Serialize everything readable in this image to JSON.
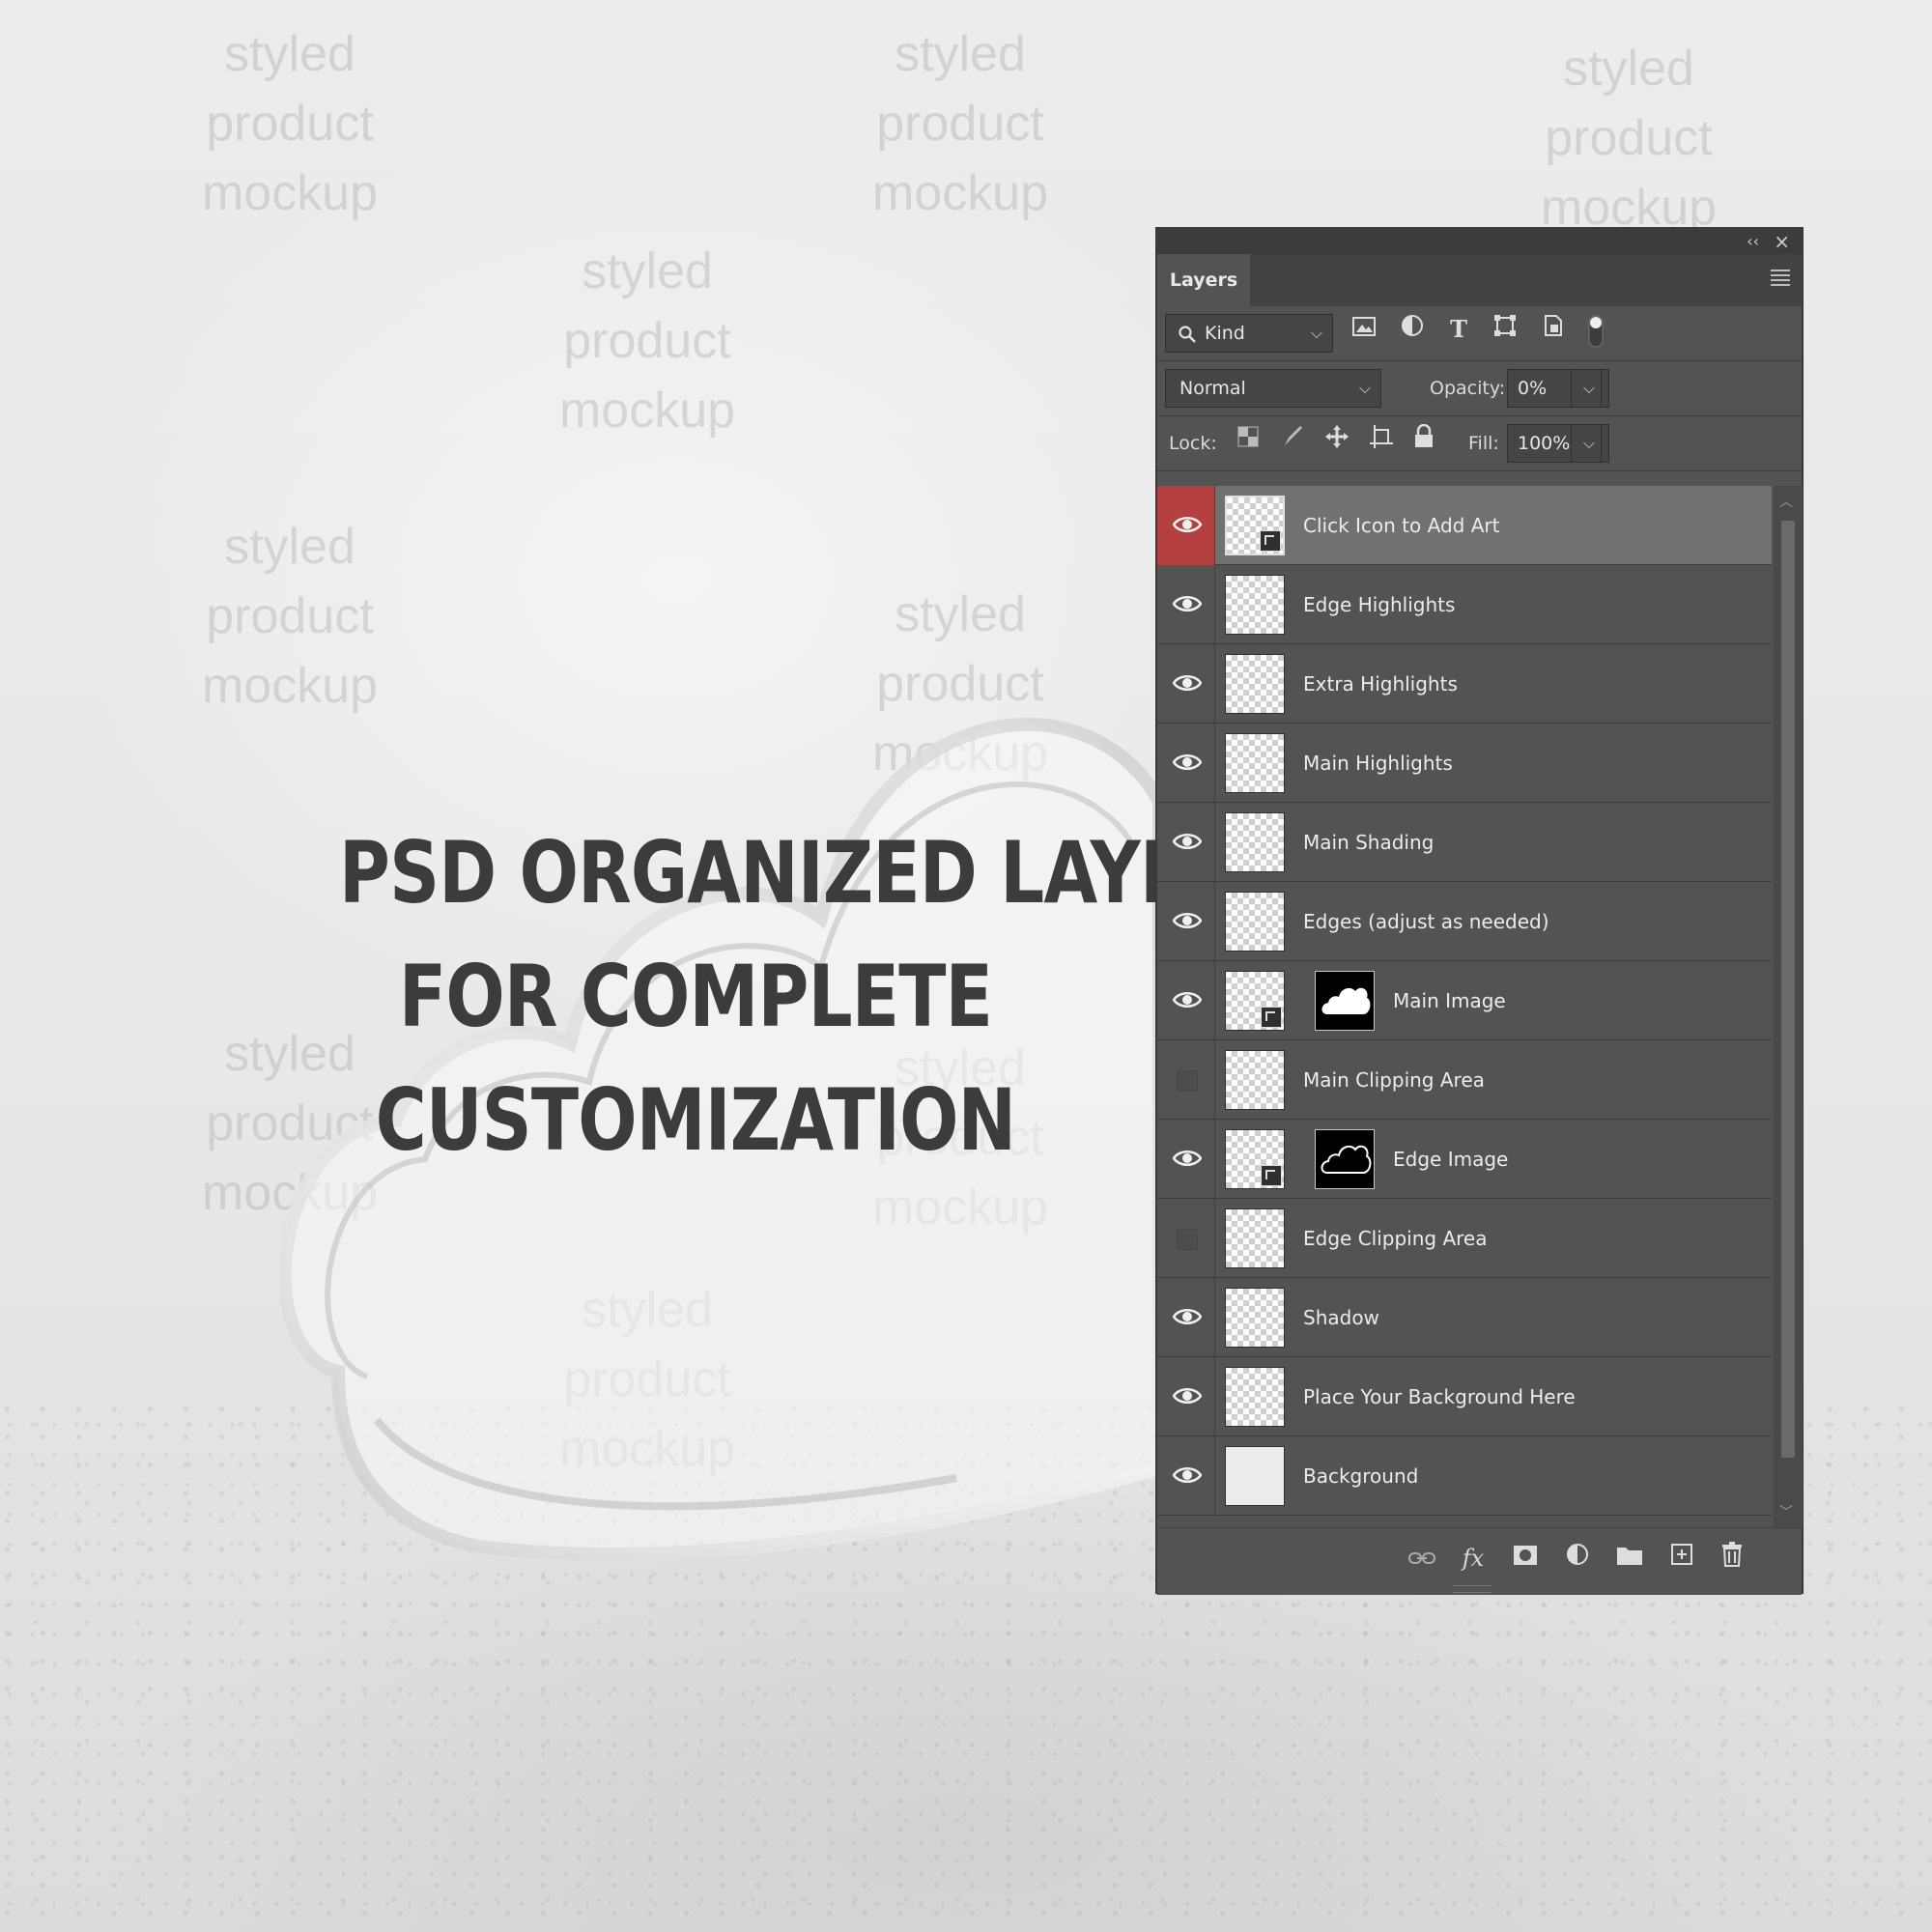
{
  "watermark": {
    "line1": "styled",
    "line2": "product",
    "line3": "mockup"
  },
  "headline": {
    "line1": "PSD ORGANIZED LAYERS",
    "line2": "FOR COMPLETE",
    "line3": "CUSTOMIZATION"
  },
  "panel": {
    "collapse_glyph": "‹‹",
    "close_glyph": "×",
    "tab_label": "Layers",
    "filter": {
      "kind_label": "Kind",
      "icons": [
        "image-filter-icon",
        "adjustment-filter-icon",
        "type-filter-icon",
        "shape-filter-icon",
        "smart-object-filter-icon",
        "filter-toggle-icon"
      ]
    },
    "blend_mode": "Normal",
    "opacity_label": "Opacity:",
    "opacity_value": "0%",
    "lock_label": "Lock:",
    "fill_label": "Fill:",
    "fill_value": "100%",
    "layers": [
      {
        "name": "Click Icon to Add Art",
        "visible": true,
        "selected": true,
        "thumb": "smart-object",
        "mask": ""
      },
      {
        "name": "Edge Highlights",
        "visible": true,
        "selected": false,
        "thumb": "transparent",
        "mask": ""
      },
      {
        "name": "Extra Highlights",
        "visible": true,
        "selected": false,
        "thumb": "transparent",
        "mask": ""
      },
      {
        "name": "Main Highlights",
        "visible": true,
        "selected": false,
        "thumb": "transparent",
        "mask": ""
      },
      {
        "name": "Main Shading",
        "visible": true,
        "selected": false,
        "thumb": "transparent",
        "mask": ""
      },
      {
        "name": "Edges (adjust as needed)",
        "visible": true,
        "selected": false,
        "thumb": "transparent",
        "mask": ""
      },
      {
        "name": "Main Image",
        "visible": true,
        "selected": false,
        "thumb": "smart-object",
        "mask": "cloud-filled"
      },
      {
        "name": "Main Clipping Area",
        "visible": false,
        "selected": false,
        "thumb": "transparent",
        "mask": ""
      },
      {
        "name": "Edge Image",
        "visible": true,
        "selected": false,
        "thumb": "smart-object",
        "mask": "cloud-outline"
      },
      {
        "name": "Edge Clipping Area",
        "visible": false,
        "selected": false,
        "thumb": "transparent",
        "mask": ""
      },
      {
        "name": "Shadow",
        "visible": true,
        "selected": false,
        "thumb": "transparent",
        "mask": ""
      },
      {
        "name": "Place Your Background Here",
        "visible": true,
        "selected": false,
        "thumb": "transparent",
        "mask": ""
      },
      {
        "name": "Background",
        "visible": true,
        "selected": false,
        "thumb": "solid",
        "mask": ""
      }
    ],
    "bottom_icons": [
      "link-layers-icon",
      "fx-icon",
      "add-mask-icon",
      "adjustment-layer-icon",
      "new-group-icon",
      "new-layer-icon",
      "delete-layer-icon"
    ],
    "selected_accent": "#b44040"
  }
}
